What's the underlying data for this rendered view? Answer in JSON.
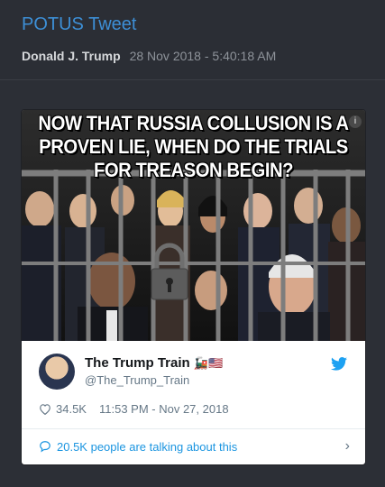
{
  "header": {
    "title": "POTUS Tweet",
    "author": "Donald J. Trump",
    "timestamp": "28 Nov 2018 - 5:40:18 AM"
  },
  "tweet_card": {
    "image_headline": "NOW THAT RUSSIA COLLUSION IS A PROVEN LIE, WHEN DO THE TRIALS FOR TREASON BEGIN?",
    "display_name": "The Trump Train",
    "name_emoji": "🚂🇺🇸",
    "handle": "@The_Trump_Train",
    "likes": "34.5K",
    "posted_at": "11:53 PM - Nov 27, 2018",
    "talking_text": "20.5K people are talking about this"
  },
  "colors": {
    "background": "#2c2f36",
    "title_blue": "#3d8fd6",
    "twitter_blue": "#1da1f2",
    "link_blue": "#1b95e0"
  }
}
